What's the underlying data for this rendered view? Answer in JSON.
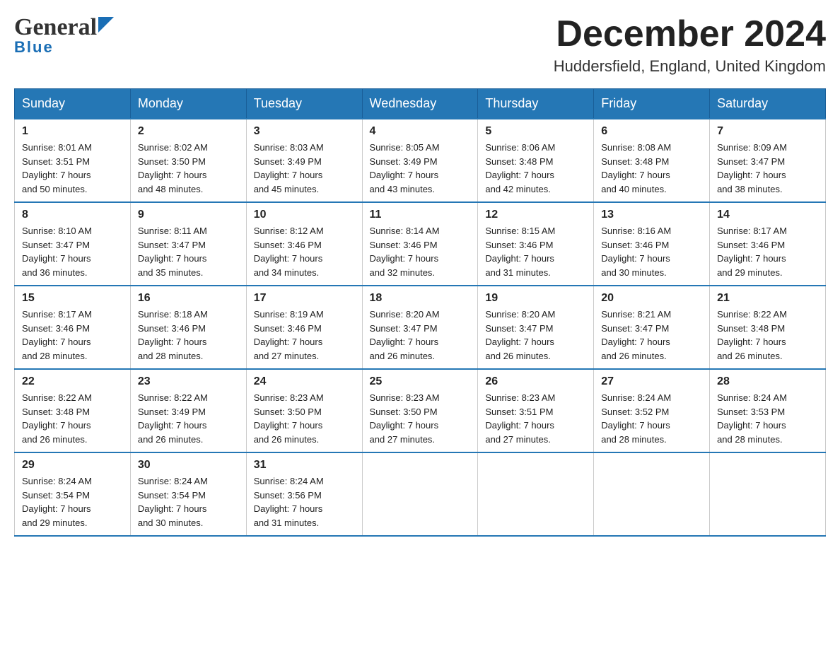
{
  "header": {
    "logo_general": "General",
    "logo_blue": "Blue",
    "title": "December 2024",
    "location": "Huddersfield, England, United Kingdom"
  },
  "days_of_week": [
    "Sunday",
    "Monday",
    "Tuesday",
    "Wednesday",
    "Thursday",
    "Friday",
    "Saturday"
  ],
  "weeks": [
    [
      {
        "day": "1",
        "sunrise": "8:01 AM",
        "sunset": "3:51 PM",
        "daylight": "7 hours and 50 minutes."
      },
      {
        "day": "2",
        "sunrise": "8:02 AM",
        "sunset": "3:50 PM",
        "daylight": "7 hours and 48 minutes."
      },
      {
        "day": "3",
        "sunrise": "8:03 AM",
        "sunset": "3:49 PM",
        "daylight": "7 hours and 45 minutes."
      },
      {
        "day": "4",
        "sunrise": "8:05 AM",
        "sunset": "3:49 PM",
        "daylight": "7 hours and 43 minutes."
      },
      {
        "day": "5",
        "sunrise": "8:06 AM",
        "sunset": "3:48 PM",
        "daylight": "7 hours and 42 minutes."
      },
      {
        "day": "6",
        "sunrise": "8:08 AM",
        "sunset": "3:48 PM",
        "daylight": "7 hours and 40 minutes."
      },
      {
        "day": "7",
        "sunrise": "8:09 AM",
        "sunset": "3:47 PM",
        "daylight": "7 hours and 38 minutes."
      }
    ],
    [
      {
        "day": "8",
        "sunrise": "8:10 AM",
        "sunset": "3:47 PM",
        "daylight": "7 hours and 36 minutes."
      },
      {
        "day": "9",
        "sunrise": "8:11 AM",
        "sunset": "3:47 PM",
        "daylight": "7 hours and 35 minutes."
      },
      {
        "day": "10",
        "sunrise": "8:12 AM",
        "sunset": "3:46 PM",
        "daylight": "7 hours and 34 minutes."
      },
      {
        "day": "11",
        "sunrise": "8:14 AM",
        "sunset": "3:46 PM",
        "daylight": "7 hours and 32 minutes."
      },
      {
        "day": "12",
        "sunrise": "8:15 AM",
        "sunset": "3:46 PM",
        "daylight": "7 hours and 31 minutes."
      },
      {
        "day": "13",
        "sunrise": "8:16 AM",
        "sunset": "3:46 PM",
        "daylight": "7 hours and 30 minutes."
      },
      {
        "day": "14",
        "sunrise": "8:17 AM",
        "sunset": "3:46 PM",
        "daylight": "7 hours and 29 minutes."
      }
    ],
    [
      {
        "day": "15",
        "sunrise": "8:17 AM",
        "sunset": "3:46 PM",
        "daylight": "7 hours and 28 minutes."
      },
      {
        "day": "16",
        "sunrise": "8:18 AM",
        "sunset": "3:46 PM",
        "daylight": "7 hours and 28 minutes."
      },
      {
        "day": "17",
        "sunrise": "8:19 AM",
        "sunset": "3:46 PM",
        "daylight": "7 hours and 27 minutes."
      },
      {
        "day": "18",
        "sunrise": "8:20 AM",
        "sunset": "3:47 PM",
        "daylight": "7 hours and 26 minutes."
      },
      {
        "day": "19",
        "sunrise": "8:20 AM",
        "sunset": "3:47 PM",
        "daylight": "7 hours and 26 minutes."
      },
      {
        "day": "20",
        "sunrise": "8:21 AM",
        "sunset": "3:47 PM",
        "daylight": "7 hours and 26 minutes."
      },
      {
        "day": "21",
        "sunrise": "8:22 AM",
        "sunset": "3:48 PM",
        "daylight": "7 hours and 26 minutes."
      }
    ],
    [
      {
        "day": "22",
        "sunrise": "8:22 AM",
        "sunset": "3:48 PM",
        "daylight": "7 hours and 26 minutes."
      },
      {
        "day": "23",
        "sunrise": "8:22 AM",
        "sunset": "3:49 PM",
        "daylight": "7 hours and 26 minutes."
      },
      {
        "day": "24",
        "sunrise": "8:23 AM",
        "sunset": "3:50 PM",
        "daylight": "7 hours and 26 minutes."
      },
      {
        "day": "25",
        "sunrise": "8:23 AM",
        "sunset": "3:50 PM",
        "daylight": "7 hours and 27 minutes."
      },
      {
        "day": "26",
        "sunrise": "8:23 AM",
        "sunset": "3:51 PM",
        "daylight": "7 hours and 27 minutes."
      },
      {
        "day": "27",
        "sunrise": "8:24 AM",
        "sunset": "3:52 PM",
        "daylight": "7 hours and 28 minutes."
      },
      {
        "day": "28",
        "sunrise": "8:24 AM",
        "sunset": "3:53 PM",
        "daylight": "7 hours and 28 minutes."
      }
    ],
    [
      {
        "day": "29",
        "sunrise": "8:24 AM",
        "sunset": "3:54 PM",
        "daylight": "7 hours and 29 minutes."
      },
      {
        "day": "30",
        "sunrise": "8:24 AM",
        "sunset": "3:54 PM",
        "daylight": "7 hours and 30 minutes."
      },
      {
        "day": "31",
        "sunrise": "8:24 AM",
        "sunset": "3:56 PM",
        "daylight": "7 hours and 31 minutes."
      },
      null,
      null,
      null,
      null
    ]
  ],
  "labels": {
    "sunrise": "Sunrise:",
    "sunset": "Sunset:",
    "daylight": "Daylight:"
  }
}
